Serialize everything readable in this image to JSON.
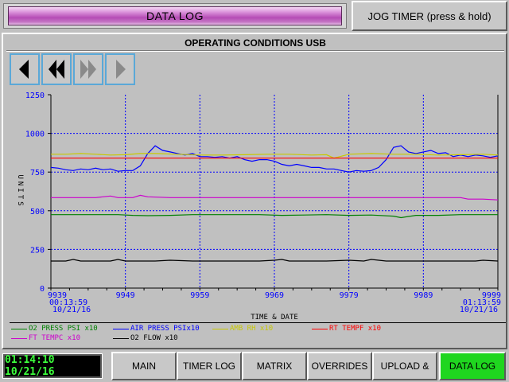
{
  "header": {
    "title": "DATA LOG",
    "jog_label": "JOG TIMER (press & hold)"
  },
  "panel": {
    "subtitle": "OPERATING CONDITIONS USB"
  },
  "nav": [
    {
      "name": "nav-first-button",
      "icon": "play-left-icon"
    },
    {
      "name": "nav-rewind-button",
      "icon": "rewind-icon"
    },
    {
      "name": "nav-fast-forward-button",
      "icon": "fast-forward-icon"
    },
    {
      "name": "nav-last-button",
      "icon": "play-right-icon"
    }
  ],
  "colors": {
    "o2_press": "#008000",
    "air_press": "#0000ff",
    "amb_rh": "#c8c800",
    "rt_temp": "#ff0000",
    "ft_temp": "#cc00cc",
    "o2_flow": "#000000",
    "grid": "#0000ff",
    "axis_text": "#0000ff",
    "clock": "#3cff3c",
    "active_menu": "#1fd61f"
  },
  "chart_data": {
    "type": "line",
    "ylabel": "UNITS",
    "xlabel": "TIME & DATE",
    "ylim": [
      0,
      1250
    ],
    "xlim": [
      9939,
      9999
    ],
    "y_ticks": [
      "0",
      "250",
      "500",
      "750",
      "1000",
      "1250"
    ],
    "x_ticks": [
      "9939",
      "9949",
      "9959",
      "9969",
      "9979",
      "9989",
      "9999"
    ],
    "x_start_time": "00:13:59",
    "x_start_date": "10/21/16",
    "x_end_time": "01:13:59",
    "x_end_date": "10/21/16",
    "grid": true,
    "legend_position": "bottom",
    "series": [
      {
        "name": "O2 PRESS PSI x10",
        "color": "#008000",
        "x": [
          9939,
          9942,
          9945,
          9948,
          9950,
          9952,
          9955,
          9958,
          9961,
          9964,
          9967,
          9970,
          9973,
          9976,
          9979,
          9982,
          9985,
          9986,
          9988,
          9991,
          9994,
          9997,
          9999
        ],
        "y": [
          475,
          475,
          475,
          475,
          470,
          468,
          470,
          475,
          475,
          475,
          475,
          470,
          472,
          475,
          470,
          472,
          465,
          455,
          470,
          470,
          475,
          475,
          475
        ]
      },
      {
        "name": "AIR PRESS PSIx10",
        "color": "#0000ff",
        "x": [
          9939,
          9940,
          9941,
          9942,
          9943,
          9944,
          9945,
          9946,
          9947,
          9948,
          9949,
          9950,
          9951,
          9952,
          9953,
          9954,
          9955,
          9956,
          9957,
          9958,
          9959,
          9960,
          9961,
          9962,
          9963,
          9964,
          9965,
          9966,
          9967,
          9968,
          9969,
          9970,
          9971,
          9972,
          9973,
          9974,
          9975,
          9976,
          9977,
          9978,
          9979,
          9980,
          9981,
          9982,
          9983,
          9984,
          9985,
          9986,
          9987,
          9988,
          9989,
          9990,
          9991,
          9992,
          9993,
          9994,
          9995,
          9996,
          9997,
          9998,
          9999
        ],
        "y": [
          780,
          775,
          765,
          760,
          770,
          765,
          775,
          765,
          770,
          755,
          760,
          760,
          790,
          870,
          920,
          890,
          880,
          870,
          860,
          870,
          850,
          850,
          845,
          850,
          840,
          850,
          830,
          820,
          830,
          830,
          820,
          800,
          790,
          800,
          790,
          780,
          780,
          770,
          770,
          760,
          750,
          760,
          755,
          760,
          780,
          830,
          910,
          920,
          880,
          870,
          880,
          890,
          870,
          875,
          850,
          860,
          850,
          860,
          855,
          845,
          855
        ]
      },
      {
        "name": "AMB RH x10",
        "color": "#c8c800",
        "x": [
          9939,
          9941,
          9943,
          9945,
          9947,
          9949,
          9951,
          9953,
          9956,
          9959,
          9962,
          9965,
          9968,
          9971,
          9974,
          9976,
          9977,
          9979,
          9982,
          9985,
          9988,
          9991,
          9994,
          9997,
          9999
        ],
        "y": [
          865,
          865,
          870,
          865,
          860,
          862,
          870,
          870,
          865,
          860,
          860,
          862,
          865,
          865,
          860,
          862,
          840,
          865,
          870,
          865,
          865,
          860,
          862,
          865,
          860
        ]
      },
      {
        "name": "RT TEMPF x10",
        "color": "#ff0000",
        "x": [
          9939,
          9999
        ],
        "y": [
          840,
          840
        ]
      },
      {
        "name": "FT TEMPC x10",
        "color": "#cc00cc",
        "x": [
          9939,
          9942,
          9945,
          9947,
          9948,
          9950,
          9951,
          9952,
          9955,
          9958,
          9961,
          9964,
          9967,
          9970,
          9973,
          9976,
          9979,
          9982,
          9985,
          9988,
          9991,
          9994,
          9995,
          9997,
          9999
        ],
        "y": [
          585,
          585,
          585,
          595,
          585,
          585,
          600,
          590,
          585,
          585,
          585,
          585,
          585,
          585,
          585,
          585,
          585,
          585,
          585,
          585,
          585,
          585,
          575,
          575,
          570
        ]
      },
      {
        "name": "O2 FLOW x10",
        "color": "#000000",
        "x": [
          9939,
          9941,
          9942,
          9943,
          9945,
          9947,
          9948,
          9949,
          9951,
          9953,
          9955,
          9958,
          9961,
          9964,
          9967,
          9969,
          9970,
          9971,
          9973,
          9976,
          9979,
          9981,
          9982,
          9984,
          9987,
          9990,
          9993,
          9996,
          9997,
          9999
        ],
        "y": [
          175,
          175,
          185,
          175,
          175,
          175,
          185,
          175,
          175,
          175,
          180,
          175,
          175,
          175,
          175,
          180,
          185,
          175,
          175,
          175,
          180,
          175,
          185,
          175,
          175,
          175,
          175,
          175,
          180,
          175
        ]
      }
    ]
  },
  "clock": {
    "value": "01:14:10 10/21/16"
  },
  "menu": [
    {
      "id": "main",
      "label": "MAIN"
    },
    {
      "id": "timer-log",
      "label": "TIMER LOG"
    },
    {
      "id": "matrix",
      "label": "MATRIX"
    },
    {
      "id": "overrides",
      "label": "OVERRIDES"
    },
    {
      "id": "upload",
      "label": "UPLOAD &"
    },
    {
      "id": "data-log",
      "label": "DATA LOG",
      "active": true
    }
  ]
}
